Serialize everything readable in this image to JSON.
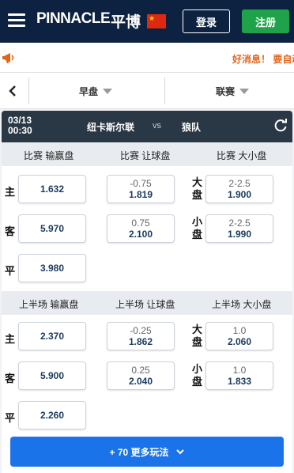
{
  "header": {
    "logo_text": "PINNACLE",
    "logo_cn": "平博",
    "login_label": "登录",
    "register_label": "注册"
  },
  "notice": {
    "text": "好消息！ 要自动"
  },
  "filters": {
    "period_label": "早盘",
    "league_label": "联赛"
  },
  "match": {
    "date": "03/13",
    "time": "00:30",
    "home": "纽卡斯尔联",
    "vs": "vs",
    "away": "狼队"
  },
  "full_time": {
    "moneyline_title": "比赛 输赢盘",
    "handicap_title": "比赛 让球盘",
    "total_title": "比赛 大小盘",
    "moneyline": [
      {
        "label": "主",
        "price": "1.632"
      },
      {
        "label": "客",
        "price": "5.970"
      },
      {
        "label": "平",
        "price": "3.980"
      }
    ],
    "handicap": [
      {
        "line": "-0.75",
        "price": "1.819"
      },
      {
        "line": "0.75",
        "price": "2.100"
      }
    ],
    "totals": [
      {
        "label": "大盘",
        "line": "2-2.5",
        "price": "1.900"
      },
      {
        "label": "小盘",
        "line": "2-2.5",
        "price": "1.990"
      }
    ]
  },
  "first_half": {
    "moneyline_title": "上半场 输赢盘",
    "handicap_title": "上半场 让球盘",
    "total_title": "上半场 大小盘",
    "moneyline": [
      {
        "label": "主",
        "price": "2.370"
      },
      {
        "label": "客",
        "price": "5.900"
      },
      {
        "label": "平",
        "price": "2.260"
      }
    ],
    "handicap": [
      {
        "line": "-0.25",
        "price": "1.862"
      },
      {
        "line": "0.25",
        "price": "2.040"
      }
    ],
    "totals": [
      {
        "label": "大盘",
        "line": "1.0",
        "price": "2.060"
      },
      {
        "label": "小盘",
        "line": "1.0",
        "price": "1.833"
      }
    ]
  },
  "more_label": "+ 70 更多玩法",
  "colors": {
    "header_bg": "#0c2240",
    "register_green": "#1ea24a",
    "notice_orange": "#e5641c",
    "match_bar": "#2a3846",
    "more_blue": "#1a73e8",
    "price_navy": "#1b3a5c"
  },
  "icons": [
    "hamburger-icon",
    "china-flag-icon",
    "megaphone-icon",
    "chevron-left-icon",
    "refresh-icon",
    "chevron-down-icon"
  ]
}
